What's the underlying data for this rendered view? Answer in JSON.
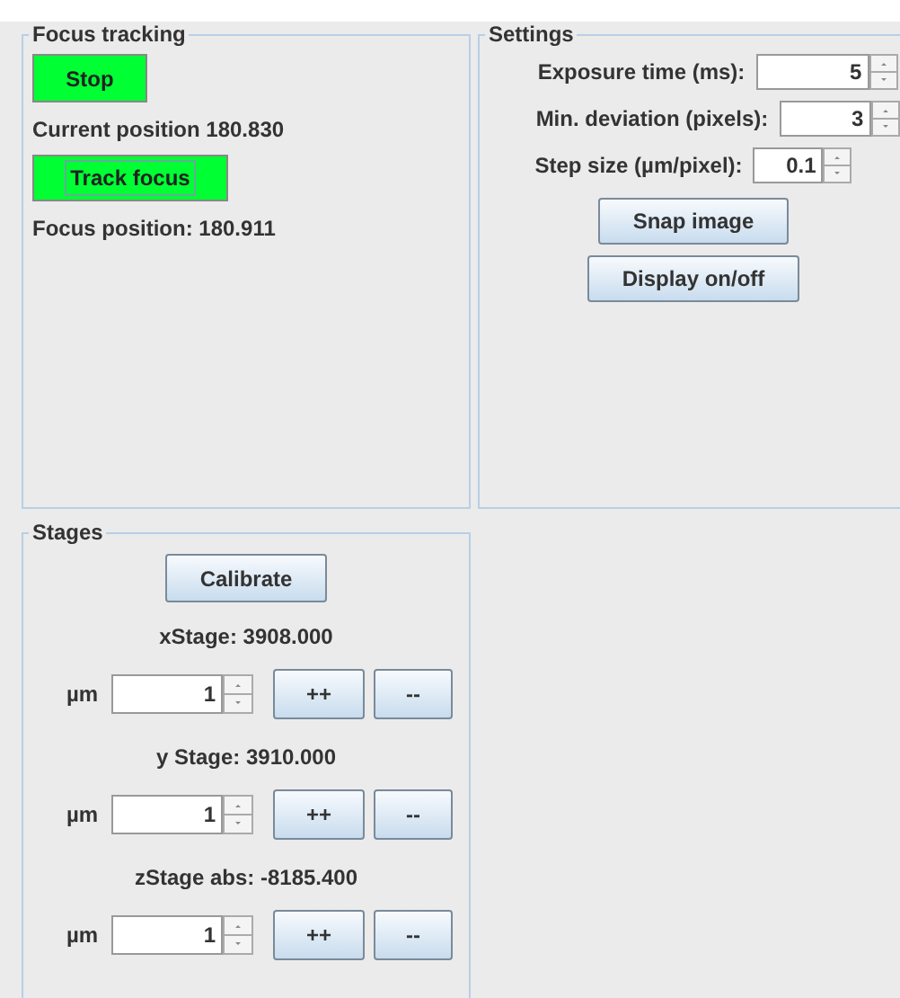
{
  "focus_tracking": {
    "title": "Focus tracking",
    "stop_button": "Stop",
    "current_position": "Current position 180.830",
    "track_button": {
      "label": "Track focus",
      "focused": true
    },
    "focus_position": "Focus position: 180.911"
  },
  "settings": {
    "title": "Settings",
    "fields": [
      {
        "label": "Exposure time (ms):",
        "value": "5"
      },
      {
        "label": "Min. deviation (pixels):",
        "value": "3"
      },
      {
        "label": "Step size (µm/pixel):",
        "value": "0.1"
      }
    ],
    "buttons": [
      "Snap image",
      "Display on/off"
    ]
  },
  "stages": {
    "title": "Stages",
    "calibrate_button": "Calibrate",
    "axes": [
      {
        "label": "xStage: 3908.000",
        "unit": "µm",
        "value": "1",
        "increase": "++",
        "decrease": "--"
      },
      {
        "label": "y Stage: 3910.000",
        "unit": "µm",
        "value": "1",
        "increase": "++",
        "decrease": "--"
      },
      {
        "label": "zStage abs: -8185.400",
        "unit": "µm",
        "value": "1",
        "increase": "++",
        "decrease": "--"
      }
    ]
  }
}
